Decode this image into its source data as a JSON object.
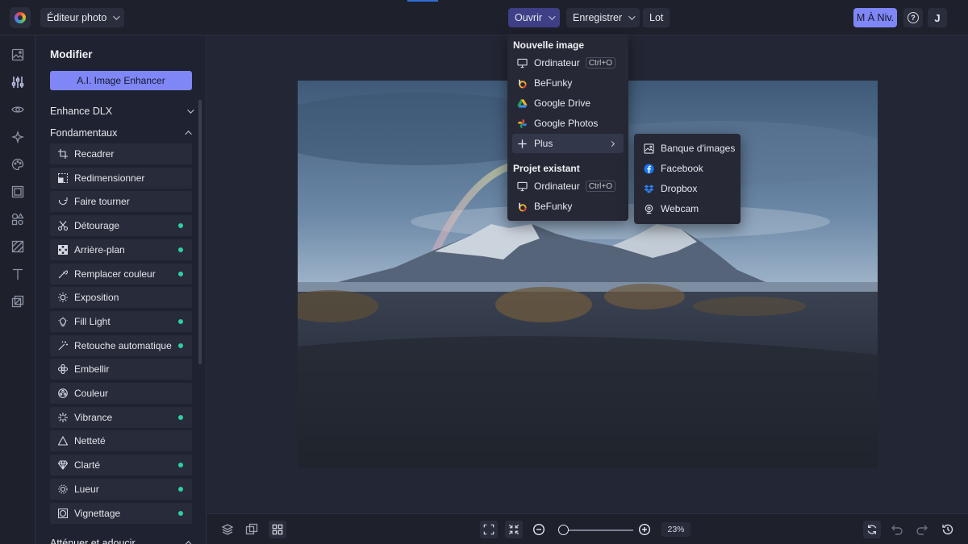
{
  "header": {
    "editor_dropdown": "Éditeur photo",
    "open_label": "Ouvrir",
    "save_label": "Enregistrer",
    "batch_label": "Lot",
    "upgrade_label": "M À Niv.",
    "help_glyph": "?",
    "avatar_initial": "J"
  },
  "panel": {
    "title": "Modifier",
    "ai_button": "A.I. Image Enhancer",
    "sections": [
      "Enhance DLX",
      "Fondamentaux",
      "Atténuer et adoucir"
    ],
    "tools": [
      {
        "label": "Recadrer",
        "icon": "crop-icon",
        "dot": false
      },
      {
        "label": "Redimensionner",
        "icon": "resize-icon",
        "dot": false
      },
      {
        "label": "Faire tourner",
        "icon": "rotate-icon",
        "dot": false
      },
      {
        "label": "Détourage",
        "icon": "cutout-icon",
        "dot": true
      },
      {
        "label": "Arrière-plan",
        "icon": "background-icon",
        "dot": true
      },
      {
        "label": "Remplacer couleur",
        "icon": "eyedropper-icon",
        "dot": true
      },
      {
        "label": "Exposition",
        "icon": "exposure-icon",
        "dot": false
      },
      {
        "label": "Fill Light",
        "icon": "bulb-icon",
        "dot": true
      },
      {
        "label": "Retouche automatique",
        "icon": "magic-wand-icon",
        "dot": true
      },
      {
        "label": "Embellir",
        "icon": "beautify-icon",
        "dot": false
      },
      {
        "label": "Couleur",
        "icon": "color-icon",
        "dot": false
      },
      {
        "label": "Vibrance",
        "icon": "vibrance-icon",
        "dot": true
      },
      {
        "label": "Netteté",
        "icon": "sharpen-icon",
        "dot": false
      },
      {
        "label": "Clarté",
        "icon": "diamond-icon",
        "dot": true
      },
      {
        "label": "Lueur",
        "icon": "glow-icon",
        "dot": true
      },
      {
        "label": "Vignettage",
        "icon": "vignette-icon",
        "dot": true
      }
    ]
  },
  "open_menu": {
    "new_image_heading": "Nouvelle image",
    "new_items": [
      {
        "label": "Ordinateur",
        "icon": "monitor-icon",
        "shortcut": "Ctrl+O"
      },
      {
        "label": "BeFunky",
        "icon": "befunky-icon"
      },
      {
        "label": "Google Drive",
        "icon": "google-drive-icon"
      },
      {
        "label": "Google Photos",
        "icon": "google-photos-icon"
      },
      {
        "label": "Plus",
        "icon": "plus-icon"
      }
    ],
    "existing_heading": "Projet existant",
    "existing_items": [
      {
        "label": "Ordinateur",
        "icon": "monitor-icon",
        "shortcut": "Ctrl+O"
      },
      {
        "label": "BeFunky",
        "icon": "befunky-icon"
      }
    ]
  },
  "more_submenu": {
    "items": [
      {
        "label": "Banque d'images",
        "icon": "image-bank-icon"
      },
      {
        "label": "Facebook",
        "icon": "facebook-icon"
      },
      {
        "label": "Dropbox",
        "icon": "dropbox-icon"
      },
      {
        "label": "Webcam",
        "icon": "webcam-icon"
      }
    ]
  },
  "bottom": {
    "zoom_percent": "23%",
    "zoom_level": 0.05
  },
  "colors": {
    "accent": "#7f86f5",
    "active_menu": "#3e3f86",
    "indicator_dot": "#2fcf9f",
    "background": "#1f2230"
  }
}
